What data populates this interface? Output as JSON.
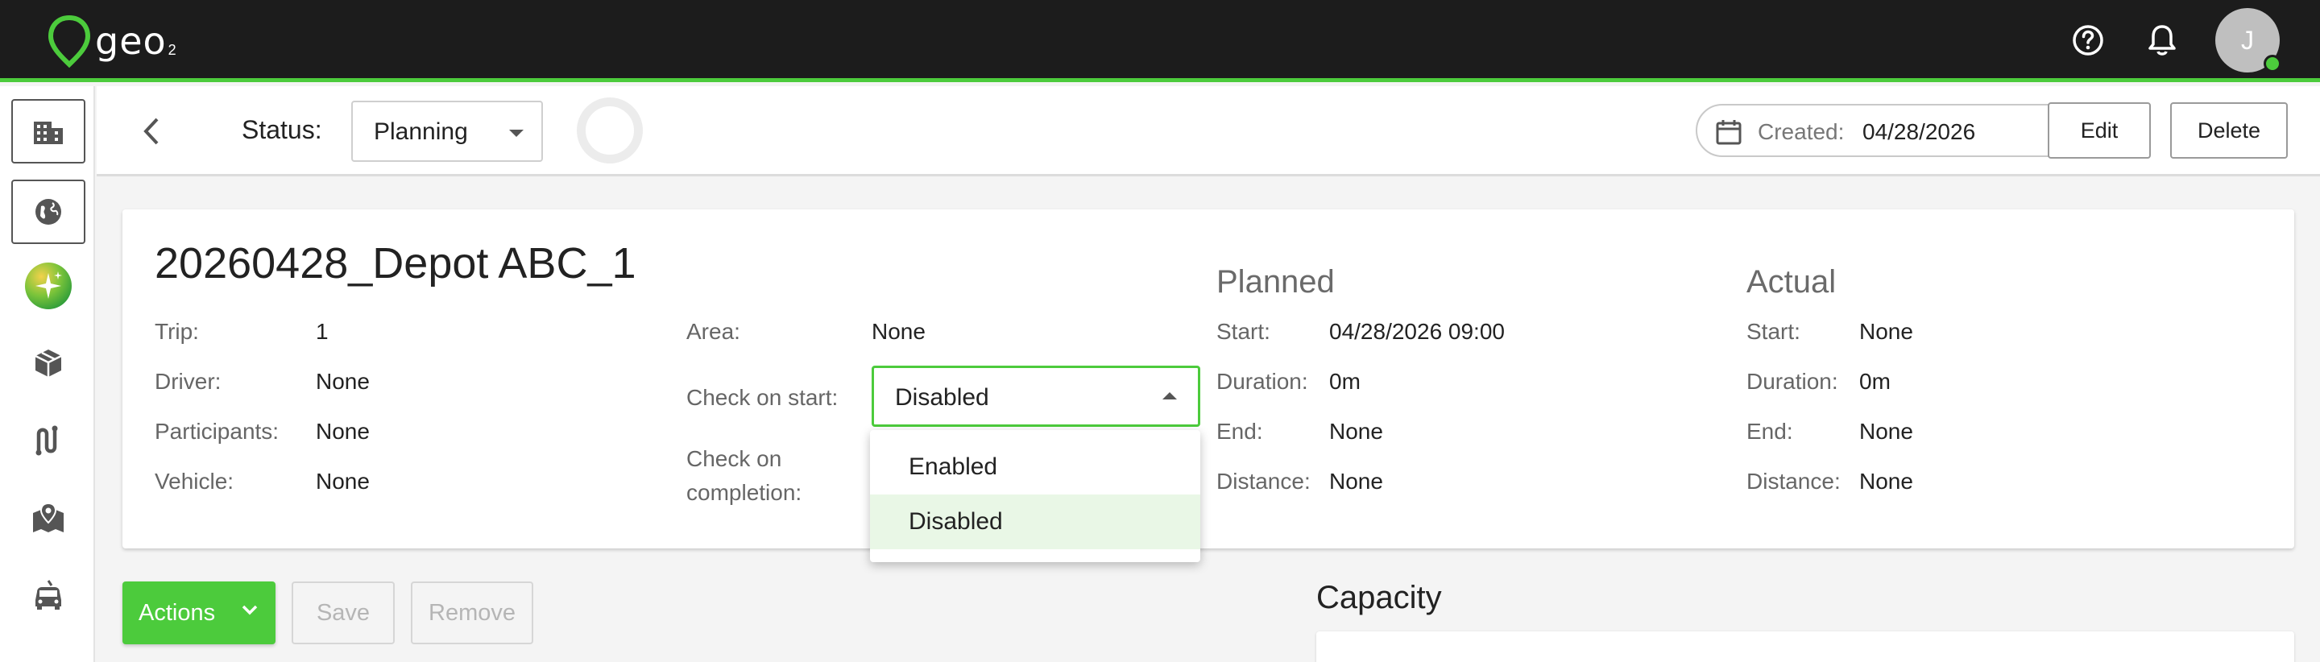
{
  "app": {
    "logo_text": "geo",
    "logo_sub": "2",
    "avatar_initial": "J",
    "colors": {
      "accent": "#4ccb3c",
      "topbar": "#1c1c1c"
    }
  },
  "topbar": {
    "icons": [
      "help-circle-icon",
      "bell-icon"
    ]
  },
  "sidebar": {
    "items": [
      {
        "name": "buildings-icon",
        "active": true
      },
      {
        "name": "globe-icon",
        "active": true
      },
      {
        "name": "sparkle-icon",
        "active": false
      },
      {
        "name": "package-icon",
        "active": false
      },
      {
        "name": "route-icon",
        "active": false
      },
      {
        "name": "map-pin-icon",
        "active": false
      },
      {
        "name": "vehicle-icon",
        "active": false
      }
    ]
  },
  "header": {
    "status_label": "Status:",
    "status_value": "Planning",
    "created_label": "Created:",
    "created_value": "04/28/2026",
    "edit_label": "Edit",
    "delete_label": "Delete"
  },
  "trip": {
    "title": "20260428_Depot ABC_1",
    "fields_left": [
      {
        "label": "Trip:",
        "value": "1"
      },
      {
        "label": "Driver:",
        "value": "None"
      },
      {
        "label": "Participants:",
        "value": "None"
      },
      {
        "label": "Vehicle:",
        "value": "None"
      }
    ],
    "area_label": "Area:",
    "area_value": "None",
    "check_start_label": "Check on start:",
    "check_start_value": "Disabled",
    "check_completion_label_1": "Check on",
    "check_completion_label_2": "completion:",
    "dropdown_options": [
      "Enabled",
      "Disabled"
    ],
    "dropdown_selected": "Disabled",
    "planned": {
      "title": "Planned",
      "fields": [
        {
          "label": "Start:",
          "value": "04/28/2026 09:00"
        },
        {
          "label": "Duration:",
          "value": "0m"
        },
        {
          "label": "End:",
          "value": "None"
        },
        {
          "label": "Distance:",
          "value": "None"
        }
      ]
    },
    "actual": {
      "title": "Actual",
      "fields": [
        {
          "label": "Start:",
          "value": "None"
        },
        {
          "label": "Duration:",
          "value": "0m"
        },
        {
          "label": "End:",
          "value": "None"
        },
        {
          "label": "Distance:",
          "value": "None"
        }
      ]
    }
  },
  "bottom": {
    "actions_label": "Actions",
    "save_label": "Save",
    "remove_label": "Remove",
    "capacity_title": "Capacity"
  }
}
